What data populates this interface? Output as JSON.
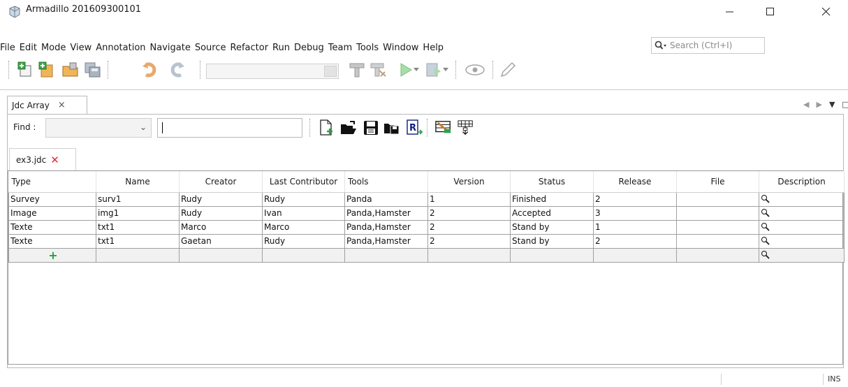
{
  "window": {
    "title": "Armadillo 201609300101"
  },
  "menu": [
    "File",
    "Edit",
    "Mode",
    "View",
    "Annotation",
    "Navigate",
    "Source",
    "Refactor",
    "Run",
    "Debug",
    "Team",
    "Tools",
    "Window",
    "Help"
  ],
  "search": {
    "placeholder": "Search (Ctrl+I)"
  },
  "toolbar": {
    "icons": [
      "new-project-icon",
      "new-file-icon",
      "open-project-icon",
      "save-all-icon",
      "undo-icon",
      "redo-icon",
      "build-icon",
      "clean-build-icon",
      "run-icon",
      "debug-icon",
      "profile-icon",
      "edit-icon"
    ],
    "config_value": ""
  },
  "panel": {
    "tab_label": "Jdc Array",
    "tab_close": "×"
  },
  "find": {
    "label": "Find :",
    "combo_value": "",
    "text_value": ""
  },
  "file_tab": {
    "label": "ex3.jdc",
    "close": "✕"
  },
  "table": {
    "columns": [
      "Type",
      "Name",
      "Creator",
      "Last Contributor",
      "Tools",
      "Version",
      "Status",
      "Release",
      "File",
      "Description"
    ],
    "rows": [
      [
        "Survey",
        "surv1",
        "Rudy",
        "Rudy",
        "Panda",
        "1",
        "Finished",
        "2",
        "",
        ""
      ],
      [
        "Image",
        "img1",
        "Rudy",
        "Ivan",
        "Panda,Hamster",
        "2",
        "Accepted",
        "3",
        "",
        ""
      ],
      [
        "Texte",
        "txt1",
        "Marco",
        "Marco",
        "Panda,Hamster",
        "2",
        "Stand by",
        "1",
        "",
        ""
      ],
      [
        "Texte",
        "txt1",
        "Gaetan",
        "Rudy",
        "Panda,Hamster",
        "2",
        "Stand by",
        "2",
        "",
        ""
      ]
    ],
    "add_row_symbol": "+"
  },
  "status": {
    "mode": "INS"
  }
}
